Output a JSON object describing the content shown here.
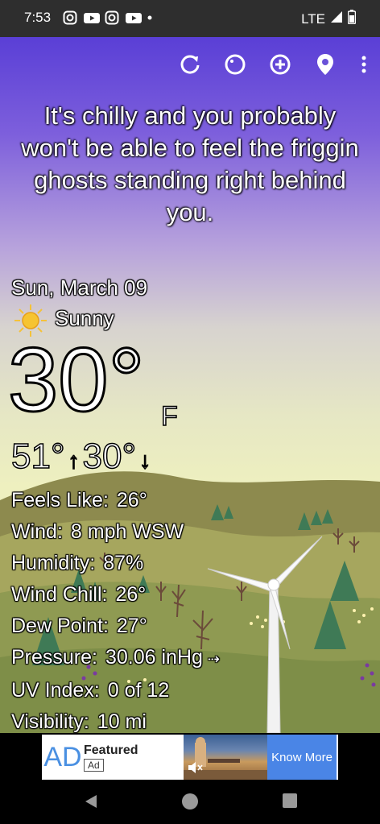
{
  "status_bar": {
    "time": "7:53",
    "network": "LTE"
  },
  "toolbar": {
    "icons": [
      "refresh-icon",
      "theme-icon",
      "add-location-icon",
      "location-pin-icon",
      "more-vert-icon"
    ]
  },
  "headline": "It's chilly and you probably won't be able to feel the friggin ghosts standing right behind you.",
  "weather": {
    "date": "Sun, March 09",
    "condition": "Sunny",
    "temperature": "30°",
    "unit": "F",
    "high": "51°",
    "low": "30°"
  },
  "details": {
    "feels_like_label": "Feels Like:",
    "feels_like_value": "26°",
    "wind_label": "Wind:",
    "wind_value": "8 mph WSW",
    "humidity_label": "Humidity:",
    "humidity_value": "87%",
    "wind_chill_label": "Wind Chill:",
    "wind_chill_value": "26°",
    "dew_point_label": "Dew Point:",
    "dew_point_value": "27°",
    "pressure_label": "Pressure:",
    "pressure_value": "30.06 inHg",
    "pressure_trend": "⇢",
    "uv_label": "UV Index:",
    "uv_value": "0 of 12",
    "visibility_label": "Visibility:",
    "visibility_value": "10 mi"
  },
  "ad": {
    "logo": "AD",
    "featured": "Featured",
    "badge": "Ad",
    "cta": "Know More"
  },
  "colors": {
    "sky_top": "#5a3fd6",
    "sky_bottom": "#eef0bf",
    "hills": "#8d8a4e",
    "cta": "#4a85e6"
  }
}
